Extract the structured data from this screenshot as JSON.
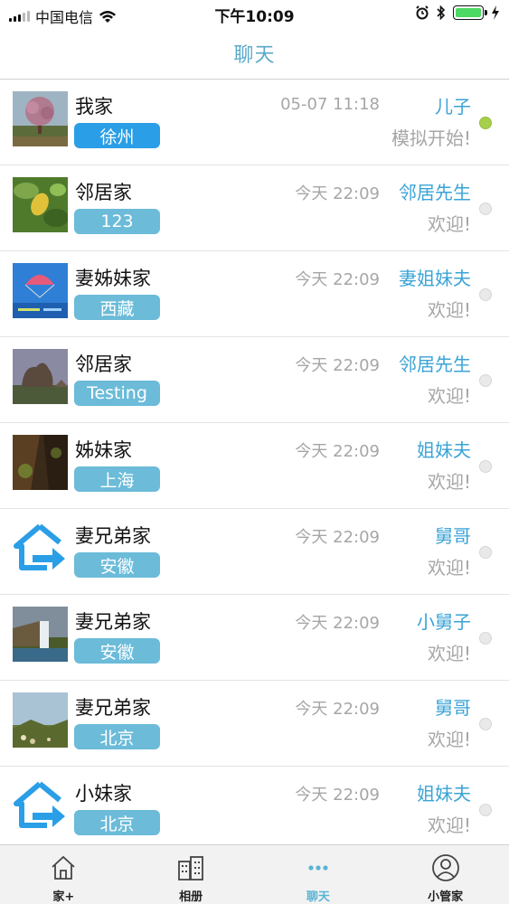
{
  "status_bar": {
    "carrier": "中国电信",
    "time": "下午10:09"
  },
  "nav": {
    "title": "聊天"
  },
  "chats": [
    {
      "family": "我家",
      "tag": "徐州",
      "time": "05-07 11:18",
      "sender": "儿子",
      "message": "模拟开始!",
      "online": true,
      "tag_active": true,
      "thumb": "photo-flower-tree"
    },
    {
      "family": "邻居家",
      "tag": "123",
      "time": "今天 22:09",
      "sender": "邻居先生",
      "message": "欢迎!",
      "online": false,
      "thumb": "photo-starfruit"
    },
    {
      "family": "妻姊妹家",
      "tag": "西藏",
      "time": "今天 22:09",
      "sender": "妻姐妹夫",
      "message": "欢迎!",
      "online": false,
      "thumb": "photo-desktop-balloon"
    },
    {
      "family": "邻居家",
      "tag": "Testing",
      "time": "今天 22:09",
      "sender": "邻居先生",
      "message": "欢迎!",
      "online": false,
      "thumb": "photo-rock"
    },
    {
      "family": "姊妹家",
      "tag": "上海",
      "time": "今天 22:09",
      "sender": "姐妹夫",
      "message": "欢迎!",
      "online": false,
      "thumb": "photo-moss"
    },
    {
      "family": "妻兄弟家",
      "tag": "安徽",
      "time": "今天 22:09",
      "sender": "舅哥",
      "message": "欢迎!",
      "online": false,
      "thumb": "home-icon"
    },
    {
      "family": "妻兄弟家",
      "tag": "安徽",
      "time": "今天 22:09",
      "sender": "小舅子",
      "message": "欢迎!",
      "online": false,
      "thumb": "photo-waterfall"
    },
    {
      "family": "妻兄弟家",
      "tag": "北京",
      "time": "今天 22:09",
      "sender": "舅哥",
      "message": "欢迎!",
      "online": false,
      "thumb": "photo-field"
    },
    {
      "family": "小妹家",
      "tag": "北京",
      "time": "今天 22:09",
      "sender": "姐妹夫",
      "message": "欢迎!",
      "online": false,
      "thumb": "home-icon"
    }
  ],
  "tabs": [
    {
      "label": "家+",
      "icon": "house-icon",
      "active": false
    },
    {
      "label": "相册",
      "icon": "building-icon",
      "active": false
    },
    {
      "label": "聊天",
      "icon": "chat-dots-icon",
      "active": true
    },
    {
      "label": "小管家",
      "icon": "person-icon",
      "active": false
    }
  ],
  "colors": {
    "accent": "#5aa9c9",
    "tag": "#6bbbd9",
    "tag_active": "#2a9ee6",
    "online_dot": "#a7cf4e"
  }
}
